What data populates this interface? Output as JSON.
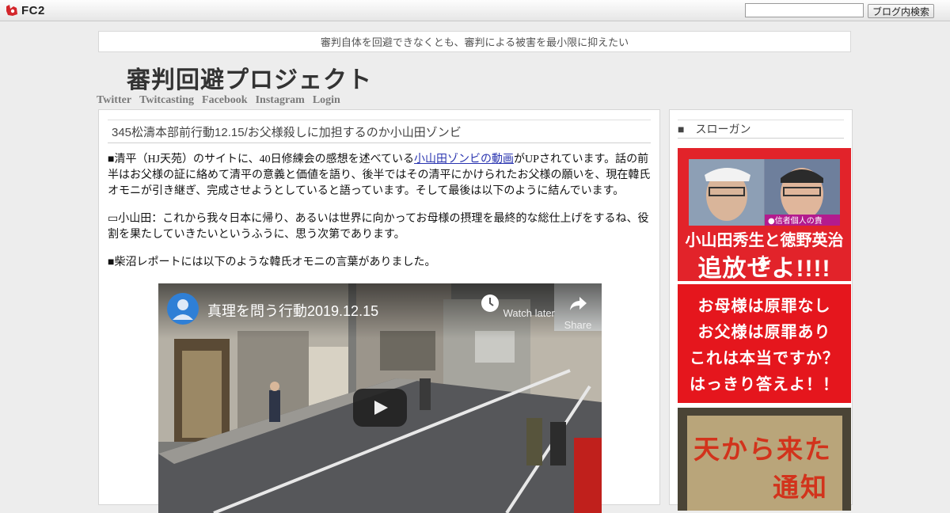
{
  "fc2": {
    "logo_text": "FC2",
    "search_placeholder": "",
    "search_button": "ブログ内検索"
  },
  "blog": {
    "tagline": "審判自体を回避できなくとも、審判による被害を最小限に抑えたい",
    "title": "審判回避プロジェクト",
    "links": [
      "Twitter",
      "Twitcasting",
      "Facebook",
      "Instagram",
      "Login"
    ]
  },
  "post": {
    "title": "345松濤本部前行動12.15/お父様殺しに加担するのか小山田ゾンビ",
    "p1_before": "■清平（HJ天苑）のサイトに、40日修練会の感想を述べている",
    "p1_link": "小山田ゾンビの動画",
    "p1_after": "がUPされています。話の前半はお父様の証に絡めて清平の意義と価値を語り、後半ではその清平にかけられたお父様の願いを、現在韓氏オモニが引き継ぎ、完成させようとしていると語っています。そして最後は以下のように結んでいます。",
    "p2": "▭小山田：これから我々日本に帰り、あるいは世界に向かってお母様の摂理を最終的な総仕上げをするね、役割を果たしていきたいというふうに、思う次第であります。",
    "p3": "■柴沼レポートには以下のような韓氏オモニの言葉がありました。"
  },
  "video": {
    "title": "真理を問う行動2019.12.15",
    "watch_later": "Watch later",
    "share": "Share"
  },
  "sidebar": {
    "heading": "■　スローガン",
    "banner1": {
      "line1": "小山田秀生と徳野英治を",
      "line2": "追放せよ!!!!",
      "photo_caption": "●信者個人の責"
    },
    "banner2": [
      "お母様は原罪なし",
      "お父様は原罪あり",
      "これは本当ですか？",
      "はっきり答えよ！！"
    ],
    "banner3": {
      "line1": "天から来た",
      "line2": "通知"
    }
  },
  "colors": {
    "link": "#2a35b0",
    "banner_red": "#e5161d",
    "youtube_avatar": "#2f7fd6"
  }
}
